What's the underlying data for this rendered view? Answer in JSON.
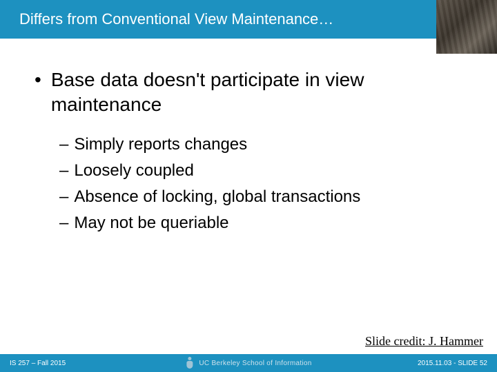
{
  "title": "Differs from Conventional View Maintenance…",
  "main_bullet": "Base data doesn't participate in view maintenance",
  "sub_bullets": [
    "Simply reports changes",
    "Loosely coupled",
    "Absence of locking, global transactions",
    "May not be queriable"
  ],
  "credit": "Slide credit: J. Hammer",
  "footer": {
    "left": "IS 257 – Fall 2015",
    "center": "UC Berkeley School of Information",
    "right": "2015.11.03 - SLIDE 52"
  }
}
